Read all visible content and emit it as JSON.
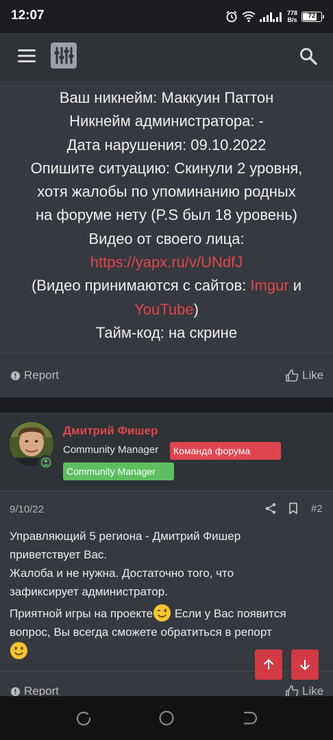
{
  "status_bar": {
    "time": "12:07",
    "net_speed_value": "778",
    "net_speed_unit": "B/s",
    "battery": "72"
  },
  "header": {
    "menu_icon": "hamburger-icon",
    "logo_icon": "equalizer-logo-icon",
    "search_icon": "search-icon"
  },
  "post1": {
    "lines": {
      "nickname": "Ваш никнейм: Маккуин Паттон",
      "admin_nickname": "Никнейм администратора: -",
      "violation_date": "Дата нарушения: 09.10.2022",
      "situation_1": "Опишите ситуацию: Скинули 2 уровня,",
      "situation_2": "хотя жалобы по упоминанию родных",
      "situation_3": "на форуме нету (P.S был 18 уровень)",
      "video_label": "Видео от своего лица:",
      "video_link": "https://yapx.ru/v/UNdfJ",
      "sites_prefix": "(Видео принимаются с сайтов: ",
      "site_imgur": "Imgur",
      "sites_and": " и",
      "site_youtube": "YouTube",
      "sites_suffix": ")",
      "timecode": "Тайм-код: на скрине"
    },
    "report_label": "Report",
    "like_label": "Like"
  },
  "post2": {
    "author": "Дмитрий Фишер",
    "user_title": "Community Manager",
    "badge_red": "Команда форума",
    "badge_green": "Community Manager",
    "date": "9/10/22",
    "post_number": "#2",
    "body": {
      "p1_line1": "Управляющий 5 региона - Дмитрий Фишер",
      "p1_line2": "приветствует Вас.",
      "p2_line1": "Жалоба и не нужна. Достаточно того, что",
      "p2_line2": "зафиксирует администратор.",
      "p3_part1": "Приятной игры на проекте",
      "p3_part2": " Если у Вас появится",
      "p3_line2": "вопрос, Вы всегда сможете обратиться в репорт"
    },
    "report_label": "Report",
    "like_label": "Like"
  },
  "colors": {
    "accent_red": "#e0454f",
    "badge_green": "#5ebf61",
    "panel": "#36393f",
    "header": "#2f3237"
  }
}
